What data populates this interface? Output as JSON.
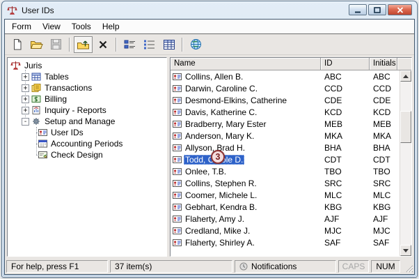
{
  "window": {
    "title": "User IDs"
  },
  "menu": {
    "items": [
      "Form",
      "View",
      "Tools",
      "Help"
    ]
  },
  "toolbar": {
    "buttons": [
      "new",
      "open",
      "save",
      "up-one-level",
      "delete",
      "small-icons-view",
      "list-view",
      "details-view",
      "web"
    ]
  },
  "tree": {
    "root": {
      "label": "Juris"
    },
    "items": [
      {
        "label": "Tables",
        "expander": "+"
      },
      {
        "label": "Transactions",
        "expander": "+"
      },
      {
        "label": "Billing",
        "expander": "+"
      },
      {
        "label": "Inquiry - Reports",
        "expander": "+"
      },
      {
        "label": "Setup and Manage",
        "expander": "-"
      }
    ],
    "children": [
      {
        "label": "User IDs"
      },
      {
        "label": "Accounting Periods"
      },
      {
        "label": "Check Design"
      }
    ]
  },
  "list": {
    "columns": [
      "Name",
      "ID",
      "Initials"
    ],
    "selected_index": 7,
    "rows": [
      [
        "Collins, Allen B.",
        "ABC",
        "ABC"
      ],
      [
        "Darwin, Caroline C.",
        "CCD",
        "CCD"
      ],
      [
        "Desmond-Elkins, Catherine",
        "CDE",
        "CDE"
      ],
      [
        "Davis, Katherine C.",
        "KCD",
        "KCD"
      ],
      [
        "Bradberry, Mary Ester",
        "MEB",
        "MEB"
      ],
      [
        "Anderson, Mary K.",
        "MKA",
        "MKA"
      ],
      [
        "Allyson, Brad H.",
        "BHA",
        "BHA"
      ],
      [
        "Todd, Carole D.",
        "CDT",
        "CDT"
      ],
      [
        "Onlee, T.B.",
        "TBO",
        "TBO"
      ],
      [
        "Collins, Stephen R.",
        "SRC",
        "SRC"
      ],
      [
        "Coomer, Michele L.",
        "MLC",
        "MLC"
      ],
      [
        "Gebhart, Kendra B.",
        "KBG",
        "KBG"
      ],
      [
        "Flaherty, Amy J.",
        "AJF",
        "AJF"
      ],
      [
        "Credland, Mike J.",
        "MJC",
        "MJC"
      ],
      [
        "Flaherty, Shirley A.",
        "SAF",
        "SAF"
      ]
    ]
  },
  "annotation": {
    "label": "3"
  },
  "statusbar": {
    "help_text": "For help, press F1",
    "item_count": "37 item(s)",
    "notifications_label": "Notifications",
    "caps_label": "CAPS",
    "num_label": "NUM"
  },
  "colors": {
    "selection": "#2e62c9",
    "titlebar": "#c2d4e7",
    "annotation_border": "#8e3333",
    "annotation_fill": "#f4dddd"
  }
}
